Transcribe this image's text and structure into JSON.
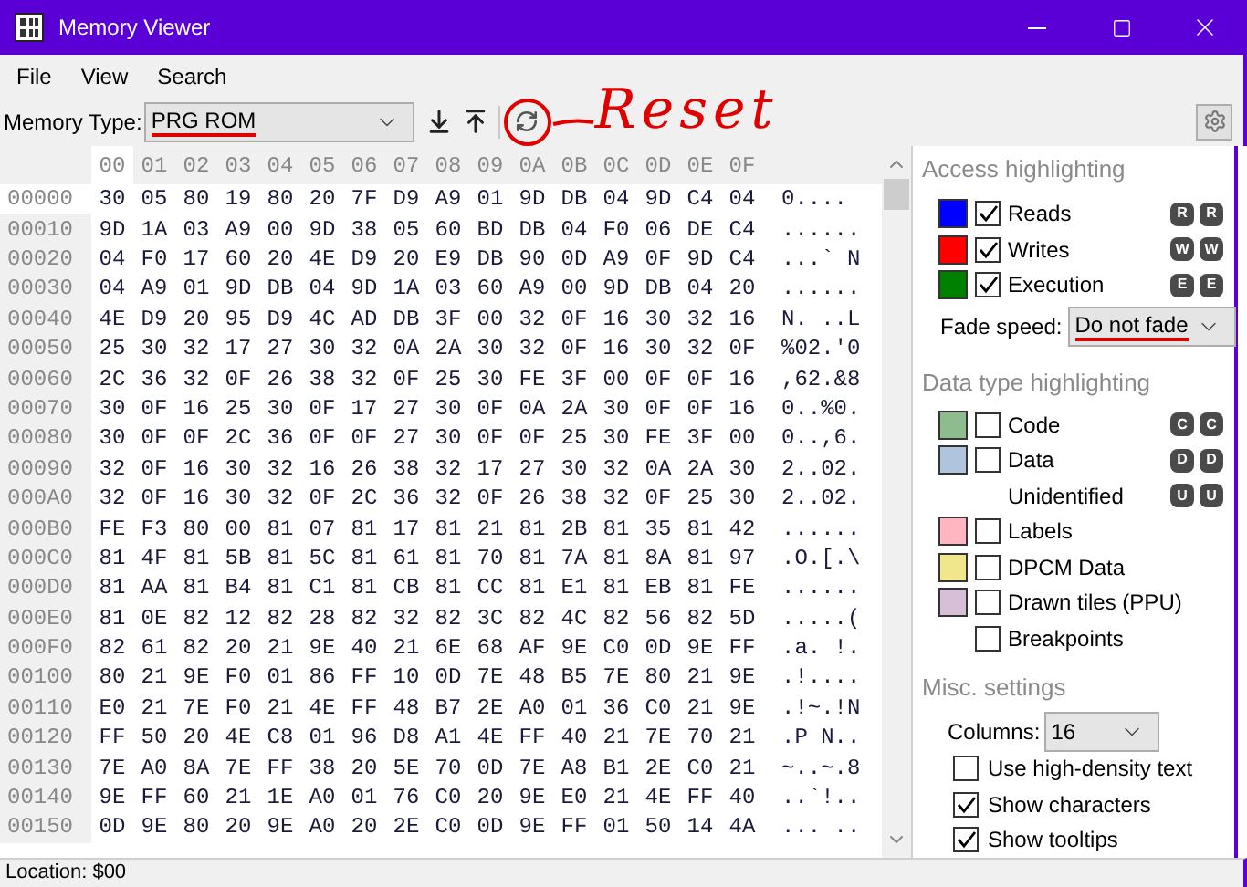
{
  "window": {
    "title": "Memory Viewer"
  },
  "menu": [
    "File",
    "View",
    "Search"
  ],
  "toolbar": {
    "memory_type_label": "Memory Type:",
    "memory_type": "PRG ROM",
    "annotation": "Reset"
  },
  "hex": {
    "columns": [
      {
        "label": "00",
        "selected": true
      },
      {
        "label": "01",
        "selected": false
      },
      {
        "label": "02",
        "selected": false
      },
      {
        "label": "03",
        "selected": false
      },
      {
        "label": "04",
        "selected": false
      },
      {
        "label": "05",
        "selected": false
      },
      {
        "label": "06",
        "selected": false
      },
      {
        "label": "07",
        "selected": false
      },
      {
        "label": "08",
        "selected": false
      },
      {
        "label": "09",
        "selected": false
      },
      {
        "label": "0A",
        "selected": false
      },
      {
        "label": "0B",
        "selected": false
      },
      {
        "label": "0C",
        "selected": false
      },
      {
        "label": "0D",
        "selected": false
      },
      {
        "label": "0E",
        "selected": false
      },
      {
        "label": "0F",
        "selected": false
      }
    ],
    "rows": [
      {
        "address": "00000",
        "selected": true,
        "bytes": [
          "30",
          "05",
          "80",
          "19",
          "80",
          "20",
          "7F",
          "D9",
          "A9",
          "01",
          "9D",
          "DB",
          "04",
          "9D",
          "C4",
          "04"
        ],
        "chars": "0...."
      },
      {
        "address": "00010",
        "selected": false,
        "bytes": [
          "9D",
          "1A",
          "03",
          "A9",
          "00",
          "9D",
          "38",
          "05",
          "60",
          "BD",
          "DB",
          "04",
          "F0",
          "06",
          "DE",
          "C4"
        ],
        "chars": "......"
      },
      {
        "address": "00020",
        "selected": false,
        "bytes": [
          "04",
          "F0",
          "17",
          "60",
          "20",
          "4E",
          "D9",
          "20",
          "E9",
          "DB",
          "90",
          "0D",
          "A9",
          "0F",
          "9D",
          "C4"
        ],
        "chars": "...` N"
      },
      {
        "address": "00030",
        "selected": false,
        "bytes": [
          "04",
          "A9",
          "01",
          "9D",
          "DB",
          "04",
          "9D",
          "1A",
          "03",
          "60",
          "A9",
          "00",
          "9D",
          "DB",
          "04",
          "20"
        ],
        "chars": "......"
      },
      {
        "address": "00040",
        "selected": false,
        "bytes": [
          "4E",
          "D9",
          "20",
          "95",
          "D9",
          "4C",
          "AD",
          "DB",
          "3F",
          "00",
          "32",
          "0F",
          "16",
          "30",
          "32",
          "16"
        ],
        "chars": "N. ..L"
      },
      {
        "address": "00050",
        "selected": false,
        "bytes": [
          "25",
          "30",
          "32",
          "17",
          "27",
          "30",
          "32",
          "0A",
          "2A",
          "30",
          "32",
          "0F",
          "16",
          "30",
          "32",
          "0F"
        ],
        "chars": "%02.'0"
      },
      {
        "address": "00060",
        "selected": false,
        "bytes": [
          "2C",
          "36",
          "32",
          "0F",
          "26",
          "38",
          "32",
          "0F",
          "25",
          "30",
          "FE",
          "3F",
          "00",
          "0F",
          "0F",
          "16"
        ],
        "chars": ",62.&8"
      },
      {
        "address": "00070",
        "selected": false,
        "bytes": [
          "30",
          "0F",
          "16",
          "25",
          "30",
          "0F",
          "17",
          "27",
          "30",
          "0F",
          "0A",
          "2A",
          "30",
          "0F",
          "0F",
          "16"
        ],
        "chars": "0..%0."
      },
      {
        "address": "00080",
        "selected": false,
        "bytes": [
          "30",
          "0F",
          "0F",
          "2C",
          "36",
          "0F",
          "0F",
          "27",
          "30",
          "0F",
          "0F",
          "25",
          "30",
          "FE",
          "3F",
          "00"
        ],
        "chars": "0..,6."
      },
      {
        "address": "00090",
        "selected": false,
        "bytes": [
          "32",
          "0F",
          "16",
          "30",
          "32",
          "16",
          "26",
          "38",
          "32",
          "17",
          "27",
          "30",
          "32",
          "0A",
          "2A",
          "30"
        ],
        "chars": "2..02."
      },
      {
        "address": "000A0",
        "selected": false,
        "bytes": [
          "32",
          "0F",
          "16",
          "30",
          "32",
          "0F",
          "2C",
          "36",
          "32",
          "0F",
          "26",
          "38",
          "32",
          "0F",
          "25",
          "30"
        ],
        "chars": "2..02."
      },
      {
        "address": "000B0",
        "selected": false,
        "bytes": [
          "FE",
          "F3",
          "80",
          "00",
          "81",
          "07",
          "81",
          "17",
          "81",
          "21",
          "81",
          "2B",
          "81",
          "35",
          "81",
          "42"
        ],
        "chars": "......"
      },
      {
        "address": "000C0",
        "selected": false,
        "bytes": [
          "81",
          "4F",
          "81",
          "5B",
          "81",
          "5C",
          "81",
          "61",
          "81",
          "70",
          "81",
          "7A",
          "81",
          "8A",
          "81",
          "97"
        ],
        "chars": ".O.[.\\"
      },
      {
        "address": "000D0",
        "selected": false,
        "bytes": [
          "81",
          "AA",
          "81",
          "B4",
          "81",
          "C1",
          "81",
          "CB",
          "81",
          "CC",
          "81",
          "E1",
          "81",
          "EB",
          "81",
          "FE"
        ],
        "chars": "......"
      },
      {
        "address": "000E0",
        "selected": false,
        "bytes": [
          "81",
          "0E",
          "82",
          "12",
          "82",
          "28",
          "82",
          "32",
          "82",
          "3C",
          "82",
          "4C",
          "82",
          "56",
          "82",
          "5D"
        ],
        "chars": ".....("
      },
      {
        "address": "000F0",
        "selected": false,
        "bytes": [
          "82",
          "61",
          "82",
          "20",
          "21",
          "9E",
          "40",
          "21",
          "6E",
          "68",
          "AF",
          "9E",
          "C0",
          "0D",
          "9E",
          "FF"
        ],
        "chars": ".a. !."
      },
      {
        "address": "00100",
        "selected": false,
        "bytes": [
          "80",
          "21",
          "9E",
          "F0",
          "01",
          "86",
          "FF",
          "10",
          "0D",
          "7E",
          "48",
          "B5",
          "7E",
          "80",
          "21",
          "9E"
        ],
        "chars": ".!...."
      },
      {
        "address": "00110",
        "selected": false,
        "bytes": [
          "E0",
          "21",
          "7E",
          "F0",
          "21",
          "4E",
          "FF",
          "48",
          "B7",
          "2E",
          "A0",
          "01",
          "36",
          "C0",
          "21",
          "9E"
        ],
        "chars": ".!~.!N"
      },
      {
        "address": "00120",
        "selected": false,
        "bytes": [
          "FF",
          "50",
          "20",
          "4E",
          "C8",
          "01",
          "96",
          "D8",
          "A1",
          "4E",
          "FF",
          "40",
          "21",
          "7E",
          "70",
          "21"
        ],
        "chars": ".P N.."
      },
      {
        "address": "00130",
        "selected": false,
        "bytes": [
          "7E",
          "A0",
          "8A",
          "7E",
          "FF",
          "38",
          "20",
          "5E",
          "70",
          "0D",
          "7E",
          "A8",
          "B1",
          "2E",
          "C0",
          "21"
        ],
        "chars": "~..~.8"
      },
      {
        "address": "00140",
        "selected": false,
        "bytes": [
          "9E",
          "FF",
          "60",
          "21",
          "1E",
          "A0",
          "01",
          "76",
          "C0",
          "20",
          "9E",
          "E0",
          "21",
          "4E",
          "FF",
          "40"
        ],
        "chars": "..`!.."
      },
      {
        "address": "00150",
        "selected": false,
        "bytes": [
          "0D",
          "9E",
          "80",
          "20",
          "9E",
          "A0",
          "20",
          "2E",
          "C0",
          "0D",
          "9E",
          "FF",
          "01",
          "50",
          "14",
          "4A"
        ],
        "chars": "... .."
      }
    ]
  },
  "access_highlighting": {
    "title": "Access highlighting",
    "items": [
      {
        "label": "Reads",
        "color": "#0000ff",
        "checked": true,
        "badges": [
          "R",
          "R"
        ]
      },
      {
        "label": "Writes",
        "color": "#ff0000",
        "checked": true,
        "badges": [
          "W",
          "W"
        ]
      },
      {
        "label": "Execution",
        "color": "#008000",
        "checked": true,
        "badges": [
          "E",
          "E"
        ]
      }
    ],
    "fade_speed_label": "Fade speed:",
    "fade_speed": "Do not fade"
  },
  "data_type_highlighting": {
    "title": "Data type highlighting",
    "items": [
      {
        "kind": "color",
        "label": "Code",
        "color": "#8fbc8f",
        "checked": false,
        "badges": [
          "C",
          "C"
        ]
      },
      {
        "kind": "color",
        "label": "Data",
        "color": "#b0c4de",
        "checked": false,
        "badges": [
          "D",
          "D"
        ]
      },
      {
        "kind": "plain",
        "label": "Unidentified",
        "badges": [
          "U",
          "U"
        ]
      },
      {
        "kind": "color",
        "label": "Labels",
        "color": "#ffb6c1",
        "checked": false
      },
      {
        "kind": "color",
        "label": "DPCM Data",
        "color": "#f0e68c",
        "checked": false
      },
      {
        "kind": "color",
        "label": "Drawn tiles (PPU)",
        "color": "#d8bfd8",
        "checked": false
      },
      {
        "kind": "check",
        "label": "Breakpoints",
        "checked": false
      }
    ]
  },
  "misc_settings": {
    "title": "Misc. settings",
    "columns_label": "Columns:",
    "columns": "16",
    "options": [
      {
        "label": "Use high-density text",
        "checked": false
      },
      {
        "label": "Show characters",
        "checked": true
      },
      {
        "label": "Show tooltips",
        "checked": true
      }
    ]
  },
  "status_bar": {
    "location": "Location: $00"
  }
}
